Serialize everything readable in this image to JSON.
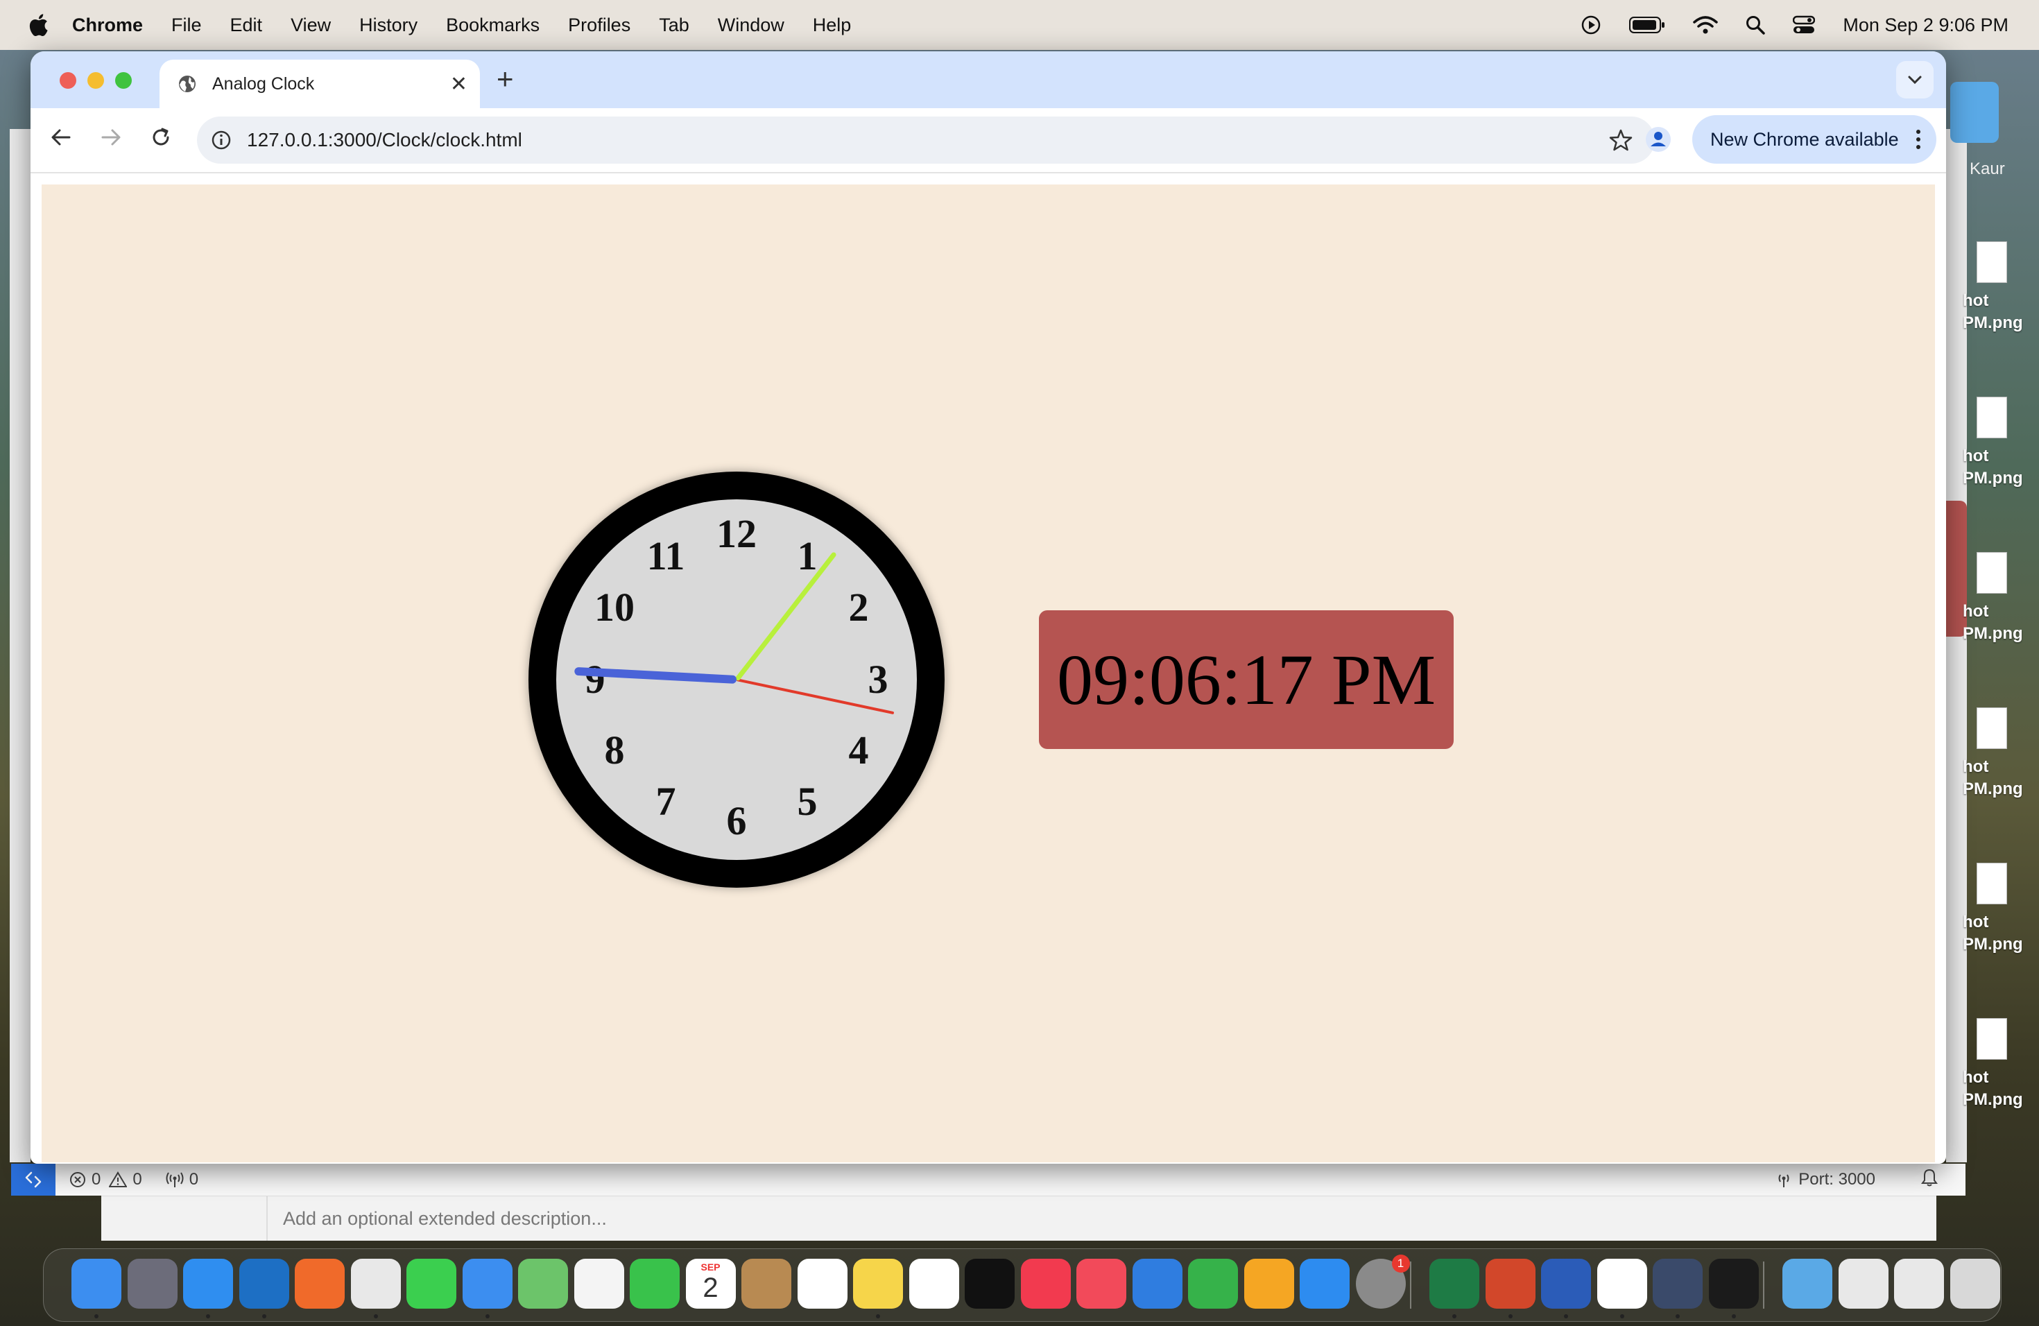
{
  "menubar": {
    "app_name": "Chrome",
    "items": [
      "File",
      "Edit",
      "View",
      "History",
      "Bookmarks",
      "Profiles",
      "Tab",
      "Window",
      "Help"
    ],
    "datetime": "Mon Sep 2  9:06 PM"
  },
  "browser": {
    "tab_title": "Analog Clock",
    "url": "127.0.0.1:3000/Clock/clock.html",
    "update_button": "New Chrome available"
  },
  "clock": {
    "numerals": [
      "12",
      "1",
      "2",
      "3",
      "4",
      "5",
      "6",
      "7",
      "8",
      "9",
      "10",
      "11"
    ],
    "digital_time": "09:06:17 PM",
    "hands": {
      "hour": 9.1,
      "minute": 6.3,
      "second": 17
    },
    "colors": {
      "hour_hand": "#4a63d8",
      "minute_hand": "#b8f03c",
      "second_hand": "#e23a2a",
      "display_bg": "#b55451",
      "page_bg": "#f7eada"
    }
  },
  "vscode_status": {
    "errors": "0",
    "warnings": "0",
    "ports_count": "0",
    "port_label": "Port: 3000"
  },
  "commit_placeholder": "Add an optional extended description...",
  "desktop": {
    "side_label_top": "Kaur",
    "files": [
      "hot\nPM.png",
      "hot\nPM.png",
      "hot\nPM.png",
      "hot\nPM.png",
      "hot\nPM.png",
      "hot\nPM.png"
    ]
  },
  "dock": {
    "calendar_month": "SEP",
    "calendar_day": "2",
    "settings_badge": "1",
    "apps": [
      "finder-icon",
      "launchpad-icon",
      "safari-icon",
      "vscode-icon",
      "pen-app-icon",
      "chrome-icon",
      "messages-icon",
      "mail-icon",
      "maps-icon",
      "photos-icon",
      "facetime-icon",
      "calendar-icon",
      "contacts-icon",
      "reminders-icon",
      "notes-icon",
      "freeform-icon",
      "appletv-icon",
      "music-icon",
      "news-icon",
      "keynote-icon",
      "numbers-icon",
      "pages-icon",
      "appstore-icon",
      "settings-icon",
      "excel-icon",
      "powerpoint-icon",
      "word-icon",
      "slack-icon",
      "preview-icon",
      "terminal-icon",
      "folder-icon",
      "screenshot-icon",
      "screenshot2-icon",
      "trash-icon"
    ]
  }
}
